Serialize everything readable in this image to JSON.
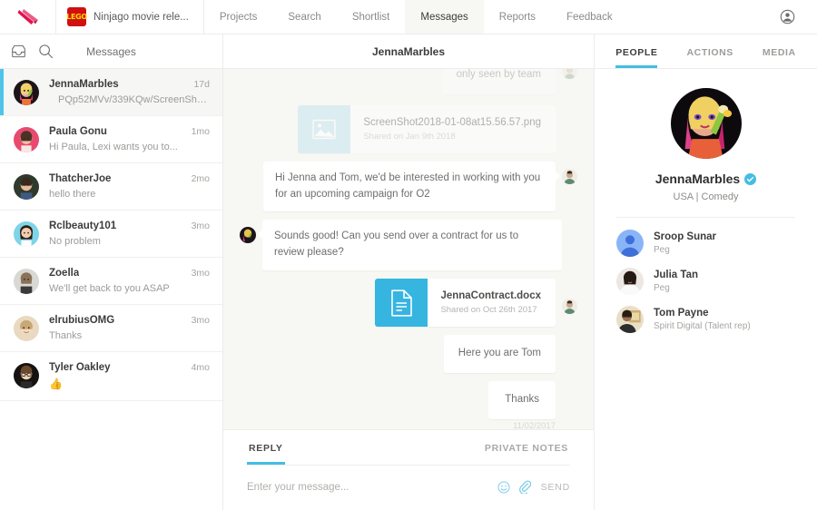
{
  "topnav": {
    "brand_icon": "talent-logo-icon",
    "project": {
      "logo_text": "LEGO",
      "name": "Ninjago movie rele..."
    },
    "items": [
      {
        "label": "Projects",
        "active": false
      },
      {
        "label": "Search",
        "active": false
      },
      {
        "label": "Shortlist",
        "active": false
      },
      {
        "label": "Messages",
        "active": true
      },
      {
        "label": "Reports",
        "active": false
      },
      {
        "label": "Feedback",
        "active": false
      }
    ],
    "account_icon": "account-circle-icon"
  },
  "sidebar": {
    "title": "Messages",
    "inbox_icon": "inbox-icon",
    "search_icon": "search-icon",
    "conversations": [
      {
        "name": "JennaMarbles",
        "time": "17d",
        "preview": "PQp52MVv/339KQw/ScreenShot2...",
        "selected": true,
        "avatar": "jennamarbles-avatar"
      },
      {
        "name": "Paula Gonu",
        "time": "1mo",
        "preview": "Hi Paula, Lexi wants you to...",
        "selected": false,
        "avatar": "paulagonu-avatar"
      },
      {
        "name": "ThatcherJoe",
        "time": "2mo",
        "preview": "hello there",
        "selected": false,
        "avatar": "thatcherjoe-avatar"
      },
      {
        "name": "Rclbeauty101",
        "time": "3mo",
        "preview": "No problem",
        "selected": false,
        "avatar": "rclbeauty101-avatar"
      },
      {
        "name": "Zoella",
        "time": "3mo",
        "preview": "We'll get back to you ASAP",
        "selected": false,
        "avatar": "zoella-avatar"
      },
      {
        "name": "elrubiusOMG",
        "time": "3mo",
        "preview": "Thanks",
        "selected": false,
        "avatar": "elrubiusomg-avatar"
      },
      {
        "name": "Tyler Oakley",
        "time": "4mo",
        "preview": "👍",
        "selected": false,
        "avatar": "tyleroakley-avatar"
      }
    ]
  },
  "thread": {
    "header_title": "JennaMarbles",
    "cutoff_note": "only seen by team",
    "image_attachment": {
      "name": "ScreenShot2018-01-08at15.56.57.png",
      "shared": "Shared on Jan 9th 2018",
      "icon": "image-file-icon"
    },
    "messages": [
      {
        "text": "Hi Jenna and Tom, we'd be interested in working with you for an upcoming campaign for O2",
        "side": "out"
      },
      {
        "text": "Sounds good! Can you send over a contract for us to review please?",
        "side": "in"
      }
    ],
    "doc_attachment": {
      "name": "JennaContract.docx",
      "shared": "Shared on Oct 26th 2017",
      "icon": "document-file-icon"
    },
    "messages_after": [
      {
        "text": "Here you are Tom",
        "side": "out"
      },
      {
        "text": "Thanks",
        "side": "out"
      }
    ],
    "timestamp": "11/02/2017"
  },
  "composer": {
    "tabs": [
      {
        "label": "REPLY",
        "active": true
      },
      {
        "label": "PRIVATE NOTES",
        "active": false
      }
    ],
    "placeholder": "Enter your message...",
    "emoji_icon": "emoji-smiley-icon",
    "attach_icon": "paperclip-icon",
    "send_label": "SEND"
  },
  "rightpanel": {
    "tabs": [
      {
        "label": "PEOPLE",
        "active": true
      },
      {
        "label": "ACTIONS",
        "active": false
      },
      {
        "label": "MEDIA",
        "active": false
      }
    ],
    "profile": {
      "name": "JennaMarbles",
      "meta": "USA | Comedy",
      "verified_icon": "verified-badge-icon",
      "avatar": "jennamarbles-large-avatar"
    },
    "people": [
      {
        "name": "Sroop Sunar",
        "role": "Peg",
        "avatar": "sroopsunar-avatar"
      },
      {
        "name": "Julia Tan",
        "role": "Peg",
        "avatar": "juliatan-avatar"
      },
      {
        "name": "Tom Payne",
        "role": "Spirit Digital (Talent rep)",
        "avatar": "tompayne-avatar"
      }
    ]
  },
  "colors": {
    "accent": "#45bde2",
    "brand": "#e0144c",
    "doc_tile": "#36b5e0",
    "img_tile": "#b9e0ef",
    "thread_bg": "#f7f7f3"
  }
}
